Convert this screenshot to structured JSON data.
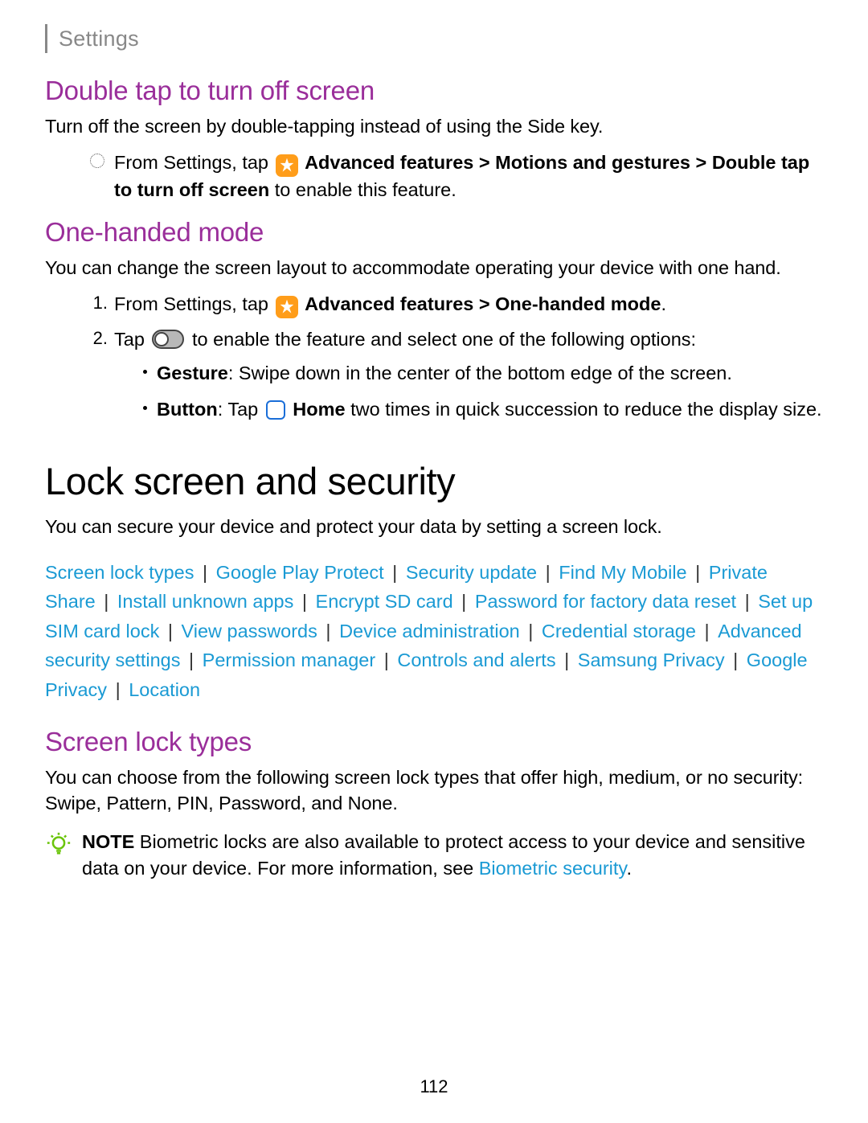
{
  "header": {
    "title": "Settings"
  },
  "section1": {
    "heading": "Double tap to turn off screen",
    "desc": "Turn off the screen by double-tapping instead of using the Side key.",
    "step_prefix": "From Settings, tap ",
    "step_af": "Advanced features",
    "step_gt1": " > ",
    "step_mg": "Motions and gestures",
    "step_gt2": " > ",
    "step_dt": "Double tap to turn off screen",
    "step_suffix": " to enable this feature."
  },
  "section2": {
    "heading": "One-handed mode",
    "desc": "You can change the screen layout to accommodate operating your device with one hand.",
    "step1_num": "1.",
    "step1_prefix": "From Settings, tap ",
    "step1_af": "Advanced features",
    "step1_gt": " > ",
    "step1_ohm": "One-handed mode",
    "step1_dot": ".",
    "step2_num": "2.",
    "step2_prefix": "Tap ",
    "step2_suffix": " to enable the feature and select one of the following options:",
    "bullet1_label": "Gesture",
    "bullet1_text": ": Swipe down in the center of the bottom edge of the screen.",
    "bullet2_label": "Button",
    "bullet2_pre": ": Tap ",
    "bullet2_home": "Home",
    "bullet2_post": " two times in quick succession to reduce the display size."
  },
  "section3": {
    "heading": "Lock screen and security",
    "desc": "You can secure your device and protect your data by setting a screen lock.",
    "links": [
      "Screen lock types",
      "Google Play Protect",
      "Security update",
      "Find My Mobile",
      "Private Share",
      "Install unknown apps",
      "Encrypt SD card",
      "Password for factory data reset",
      "Set up SIM card lock",
      "View passwords",
      "Device administration",
      "Credential storage",
      "Advanced security settings",
      "Permission manager",
      "Controls and alerts",
      "Samsung Privacy",
      "Google Privacy",
      "Location"
    ]
  },
  "section4": {
    "heading": "Screen lock types",
    "desc": "You can choose from the following screen lock types that offer high, medium, or no security: Swipe, Pattern, PIN, Password, and None.",
    "note_label": "NOTE",
    "note_text1": "  Biometric locks are also available to protect access to your device and sensitive data on your device. For more information, see ",
    "note_link": "Biometric security",
    "note_dot": "."
  },
  "page_number": "112"
}
